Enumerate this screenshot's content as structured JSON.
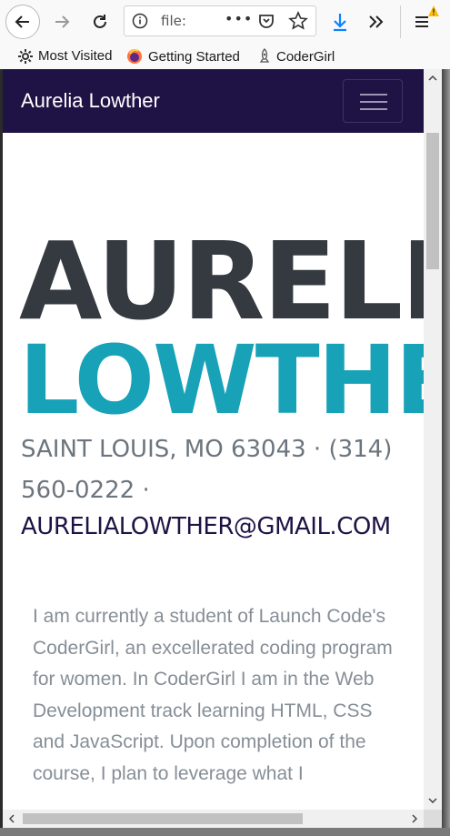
{
  "browser": {
    "url_text": "file:",
    "url_dots": "•••",
    "bookmarks": [
      {
        "label": "Most Visited"
      },
      {
        "label": "Getting Started"
      },
      {
        "label": "CoderGirl"
      }
    ]
  },
  "navbar": {
    "brand": "Aurelia Lowther"
  },
  "hero": {
    "first_name": "AURELIA",
    "last_name": "LOWTHER",
    "address": "SAINT LOUIS, MO 63043 · (314) 560-0222 ·",
    "email": "AURELIALOWTHER@GMAIL.COM"
  },
  "about": {
    "bio": "I am currently a student of Launch Code's CoderGirl, an excellerated coding program for women. In CoderGirl I am in the Web Development track learning HTML, CSS and JavaScript. Upon completion of the course, I plan to leverage what I"
  },
  "colors": {
    "navbar_bg": "#1f1345",
    "first_name": "#343a40",
    "last_name": "#17a2b8",
    "muted_text": "#6c757d"
  },
  "icons": [
    "back-arrow-icon",
    "forward-arrow-icon",
    "reload-icon",
    "info-icon",
    "page-actions-icon",
    "pocket-icon",
    "star-icon",
    "download-icon",
    "overflow-icon",
    "hamburger-menu-icon",
    "warning-icon",
    "gear-icon",
    "firefox-icon",
    "rocket-icon"
  ]
}
